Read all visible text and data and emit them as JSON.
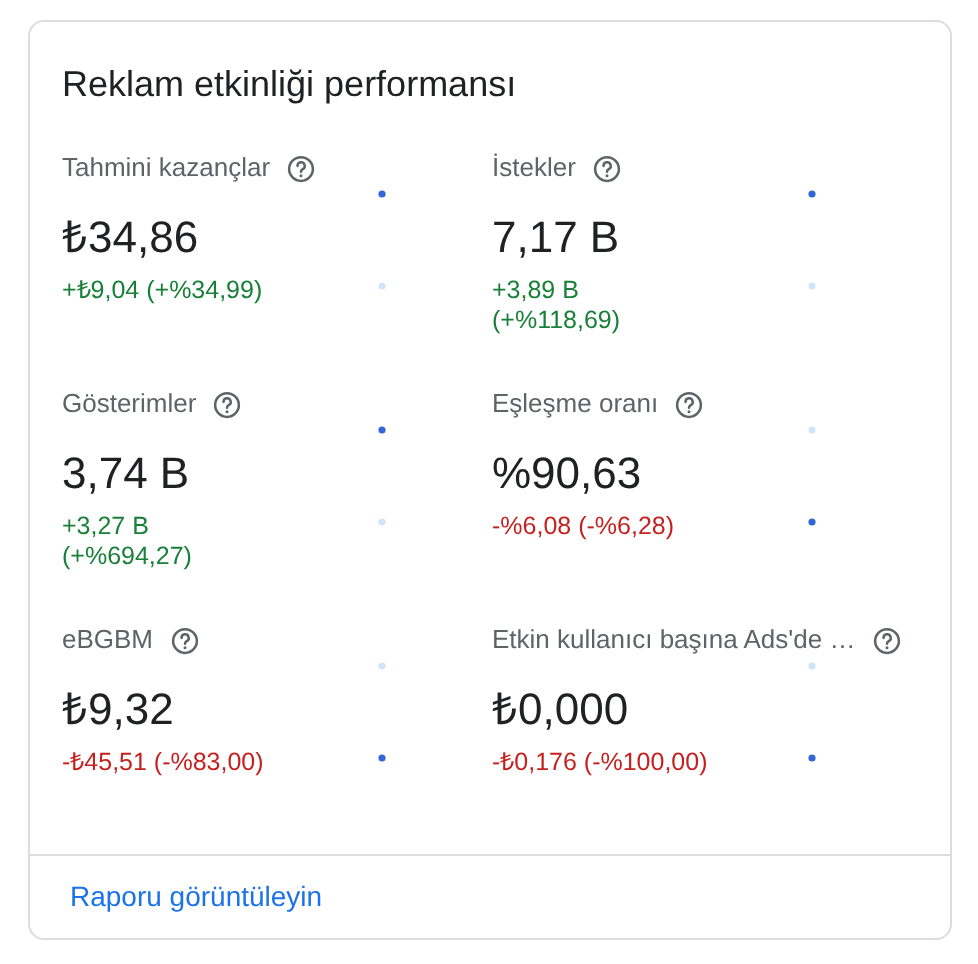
{
  "title": "Reklam etkinliği performansı",
  "metrics": [
    {
      "label": "Tahmini kazançlar",
      "value": "₺34,86",
      "change": "+₺9,04 (+%34,99)",
      "kind": "up"
    },
    {
      "label": "İstekler",
      "value": "7,17 B",
      "change": "+3,89 B (+%118,69)",
      "kind": "up"
    },
    {
      "label": "Gösterimler",
      "value": "3,74 B",
      "change": "+3,27 B (+%694,27)",
      "kind": "up"
    },
    {
      "label": "Eşleşme oranı",
      "value": "%90,63",
      "change": "-%6,08 (-%6,28)",
      "kind": "down"
    },
    {
      "label": "eBGBM",
      "value": "₺9,32",
      "change": "-₺45,51 (-%83,00)",
      "kind": "down"
    },
    {
      "label": "Etkin kullanıcı başına Ads'de …",
      "value": "₺0,000",
      "change": "-₺0,176 (-%100,00)",
      "kind": "down"
    }
  ],
  "link": "Raporu görüntüleyin"
}
